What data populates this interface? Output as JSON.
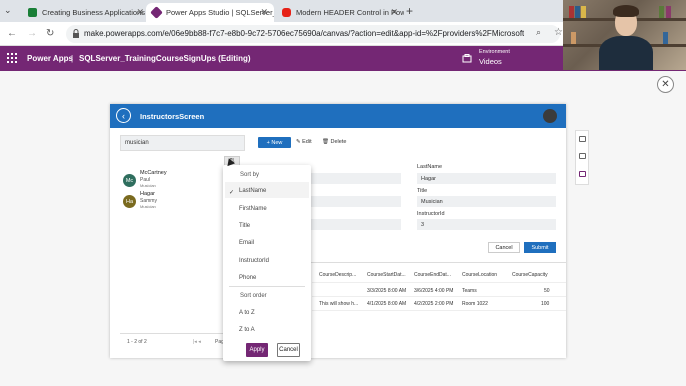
{
  "browser": {
    "tabs": [
      {
        "title": "Creating Business Applications",
        "fav_color": "#1a7f37"
      },
      {
        "title": "Power Apps Studio | SQLServer_",
        "fav_color": "#742774"
      },
      {
        "title": "Modern HEADER Control in Pow",
        "fav_color": "#e62117"
      }
    ],
    "url": "make.powerapps.com/e/06e9bb88-f7c7-e8b0-9c72-5706ec75690a/canvas/?action=edit&app-id=%2Fproviders%2FMicrosoft.PowerA..."
  },
  "powerapps_header": {
    "brand": "Power Apps",
    "sep": "|",
    "app_name": "SQLServer_TrainingCourseSignUps (Editing)",
    "env_label": "Environment",
    "env_value": "Videos"
  },
  "screen": {
    "title": "InstructorsScreen",
    "search_value": "musician",
    "list": [
      {
        "initials": "Mc",
        "line1": "McCartney",
        "line2": "Paul",
        "line3": "Musician",
        "color": "#2f6e5e"
      },
      {
        "initials": "Ha",
        "line1": "Hagar",
        "line2": "Sammy",
        "line3": "Musician",
        "color": "#7a6a1f"
      }
    ],
    "pager_text": "1 - 2 of 2",
    "pager_page": "Page"
  },
  "toolbar": {
    "new": "+ New",
    "edit": "Edit",
    "delete": "Delete"
  },
  "form": {
    "fields": [
      {
        "label": "LastName",
        "value": "Hagar"
      },
      {
        "label": "Title",
        "value": "Musician"
      },
      {
        "label": "InstructorId",
        "value": "3"
      }
    ],
    "cancel": "Cancel",
    "submit": "Submit"
  },
  "table": {
    "headers": [
      "CourseDescrip...",
      "CourseStartDat...",
      "CourseEndDat...",
      "CourseLocation",
      "CourseCapacity"
    ],
    "rows": [
      [
        "",
        "3/3/2025 8:00 AM",
        "3/6/2025 4:00 PM",
        "Teams",
        "50"
      ],
      [
        "This will show h...",
        "4/1/2025 8:00 AM",
        "4/2/2025 2:00 PM",
        "Room 1022",
        "100"
      ]
    ]
  },
  "sort_menu": {
    "sort_by": "Sort by",
    "fields": [
      "LastName",
      "FirstName",
      "Title",
      "Email",
      "InstructorId",
      "Phone"
    ],
    "selected": "LastName",
    "sort_order": "Sort order",
    "orders": [
      "A to Z",
      "Z to A"
    ],
    "apply": "Apply",
    "cancel": "Cancel"
  },
  "colors": {
    "powerapps_purple": "#742774",
    "app_blue": "#1f6fbe"
  }
}
